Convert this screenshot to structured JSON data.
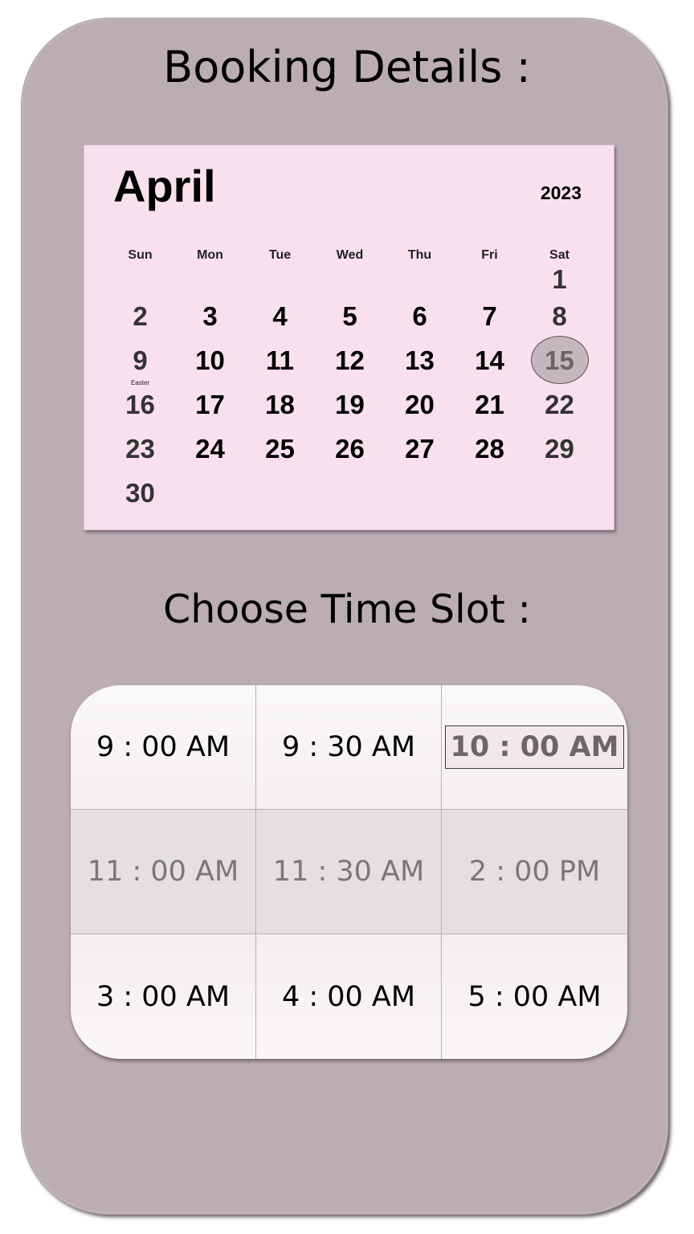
{
  "booking": {
    "title": "Booking Details :"
  },
  "calendar": {
    "month": "April",
    "year": "2023",
    "weekdays": [
      "Sun",
      "Mon",
      "Tue",
      "Wed",
      "Thu",
      "Fri",
      "Sat"
    ],
    "first_weekday_index": 6,
    "days_in_month": 30,
    "selected_day": 15,
    "holiday": {
      "day": 9,
      "label": "Easter"
    }
  },
  "timeslots": {
    "title": "Choose Time Slot :",
    "selected": "10 : 00 AM",
    "rows": [
      [
        {
          "label": "9 : 00 AM",
          "available": true
        },
        {
          "label": "9 : 30 AM",
          "available": true
        },
        {
          "label": "10 : 00 AM",
          "available": true
        }
      ],
      [
        {
          "label": "11 : 00 AM",
          "available": false
        },
        {
          "label": "11 : 30 AM",
          "available": false
        },
        {
          "label": "2 : 00 PM",
          "available": false
        }
      ],
      [
        {
          "label": "3 : 00 AM",
          "available": true
        },
        {
          "label": "4 : 00 AM",
          "available": true
        },
        {
          "label": "5 : 00 AM",
          "available": true
        }
      ]
    ]
  },
  "colors": {
    "panel": "#bcadb4",
    "calendar_bg": "#f9e0ed",
    "selected_day_fill": "#c4b7bd",
    "unavailable_slot_bg": "#e5dfe1"
  }
}
